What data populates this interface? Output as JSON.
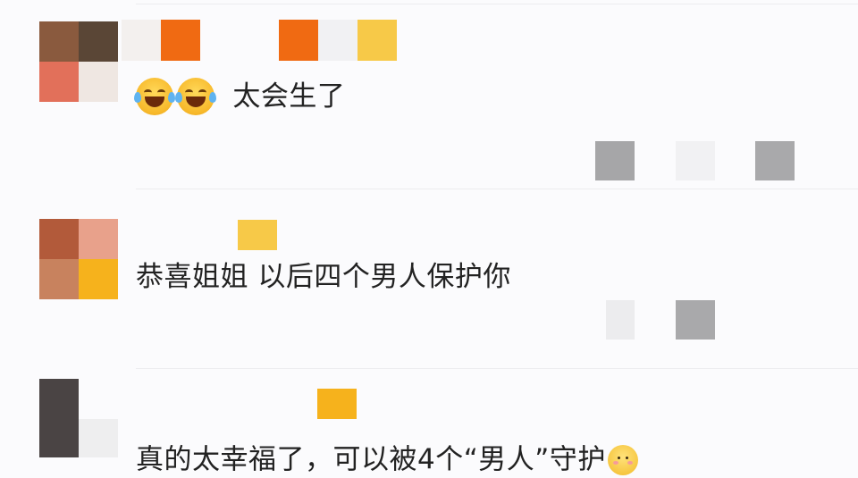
{
  "comments": [
    {
      "text": "太会生了",
      "emojis": [
        "laughing-tears",
        "laughing-tears"
      ]
    },
    {
      "text": "恭喜姐姐 以后四个男人保护你"
    },
    {
      "text": "真的太幸福了，可以被4个“男人”守护",
      "emojis": [
        "shy-face"
      ]
    }
  ],
  "colors": {
    "background": "#fbfbfd",
    "text": "#222222",
    "badge_orange": "#f06a12",
    "badge_yellow": "#f7c948"
  }
}
